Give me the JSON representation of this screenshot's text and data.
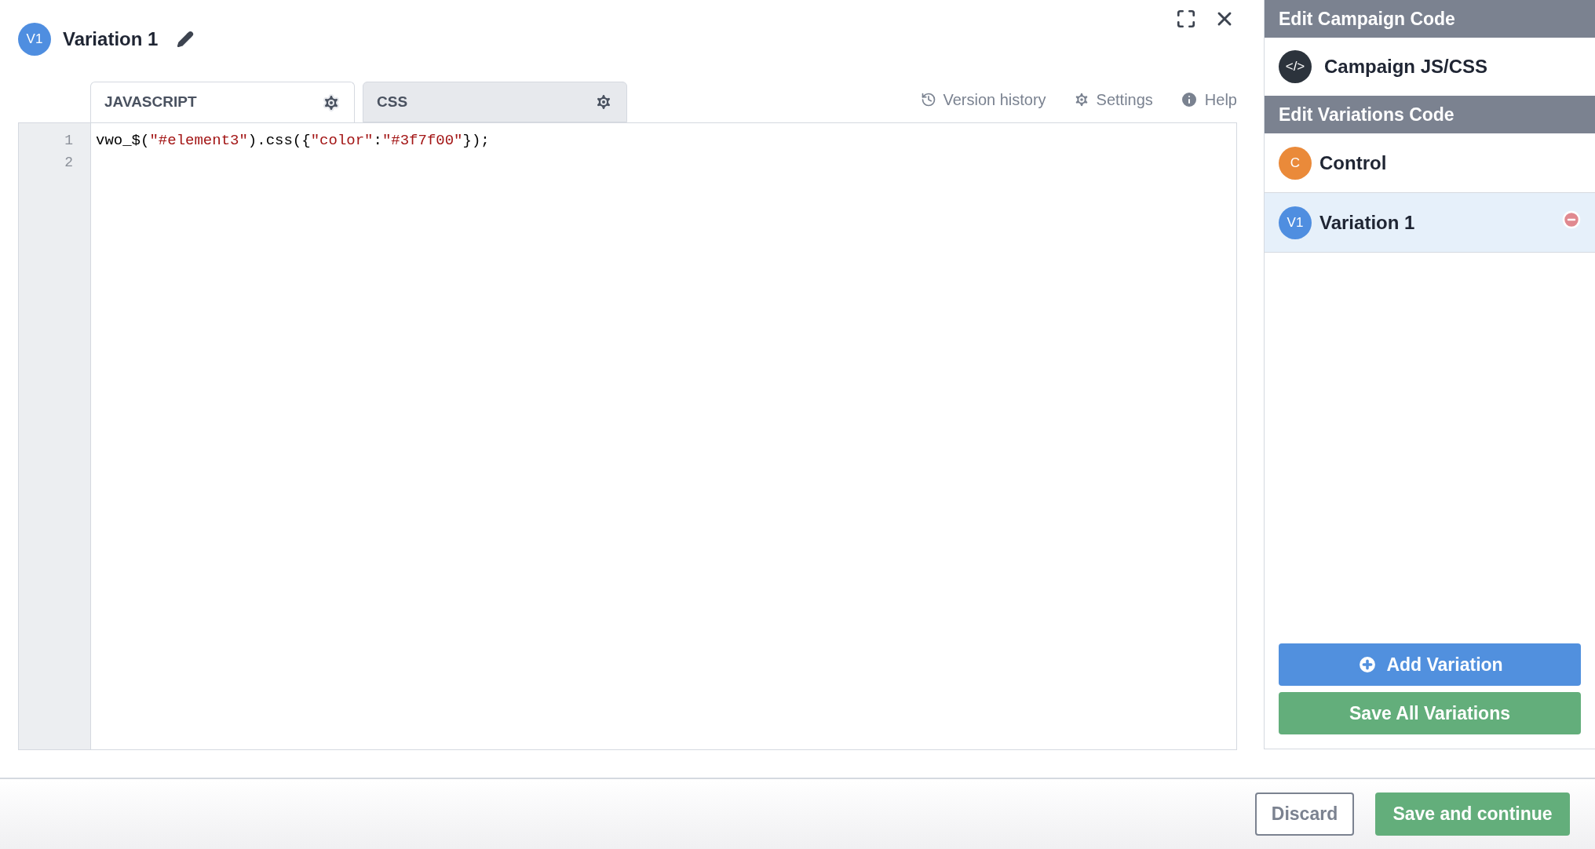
{
  "header": {
    "badge": "V1",
    "title": "Variation 1"
  },
  "tabs": [
    {
      "label": "JAVASCRIPT",
      "selected": true
    },
    {
      "label": "CSS",
      "selected": false
    }
  ],
  "toolbar": [
    "Version history",
    "Settings",
    "Help"
  ],
  "editor": {
    "lines": [
      {
        "number": "1",
        "tokens": [
          {
            "kind": "plain",
            "text": "vwo_$("
          },
          {
            "kind": "string",
            "text": "\"#element3\""
          },
          {
            "kind": "plain",
            "text": ").css({"
          },
          {
            "kind": "string",
            "text": "\"color\""
          },
          {
            "kind": "plain",
            "text": ":"
          },
          {
            "kind": "string",
            "text": "\"#3f7f00\""
          },
          {
            "kind": "plain",
            "text": "});"
          }
        ]
      },
      {
        "number": "2"
      }
    ]
  },
  "sidebar": {
    "campaign_heading": "Edit Campaign Code",
    "campaign_item": {
      "icon": "</>",
      "label": "Campaign JS/CSS"
    },
    "variations_heading": "Edit Variations Code",
    "variations": [
      {
        "badge": "C",
        "label": "Control",
        "color": "#ea8a3a",
        "selected": false,
        "removable": false
      },
      {
        "badge": "V1",
        "label": "Variation 1",
        "color": "#4f8ee0",
        "selected": true,
        "removable": true
      }
    ],
    "add_button": "Add Variation",
    "save_button": "Save All Variations"
  },
  "footer": {
    "discard": "Discard",
    "save": "Save and continue"
  }
}
